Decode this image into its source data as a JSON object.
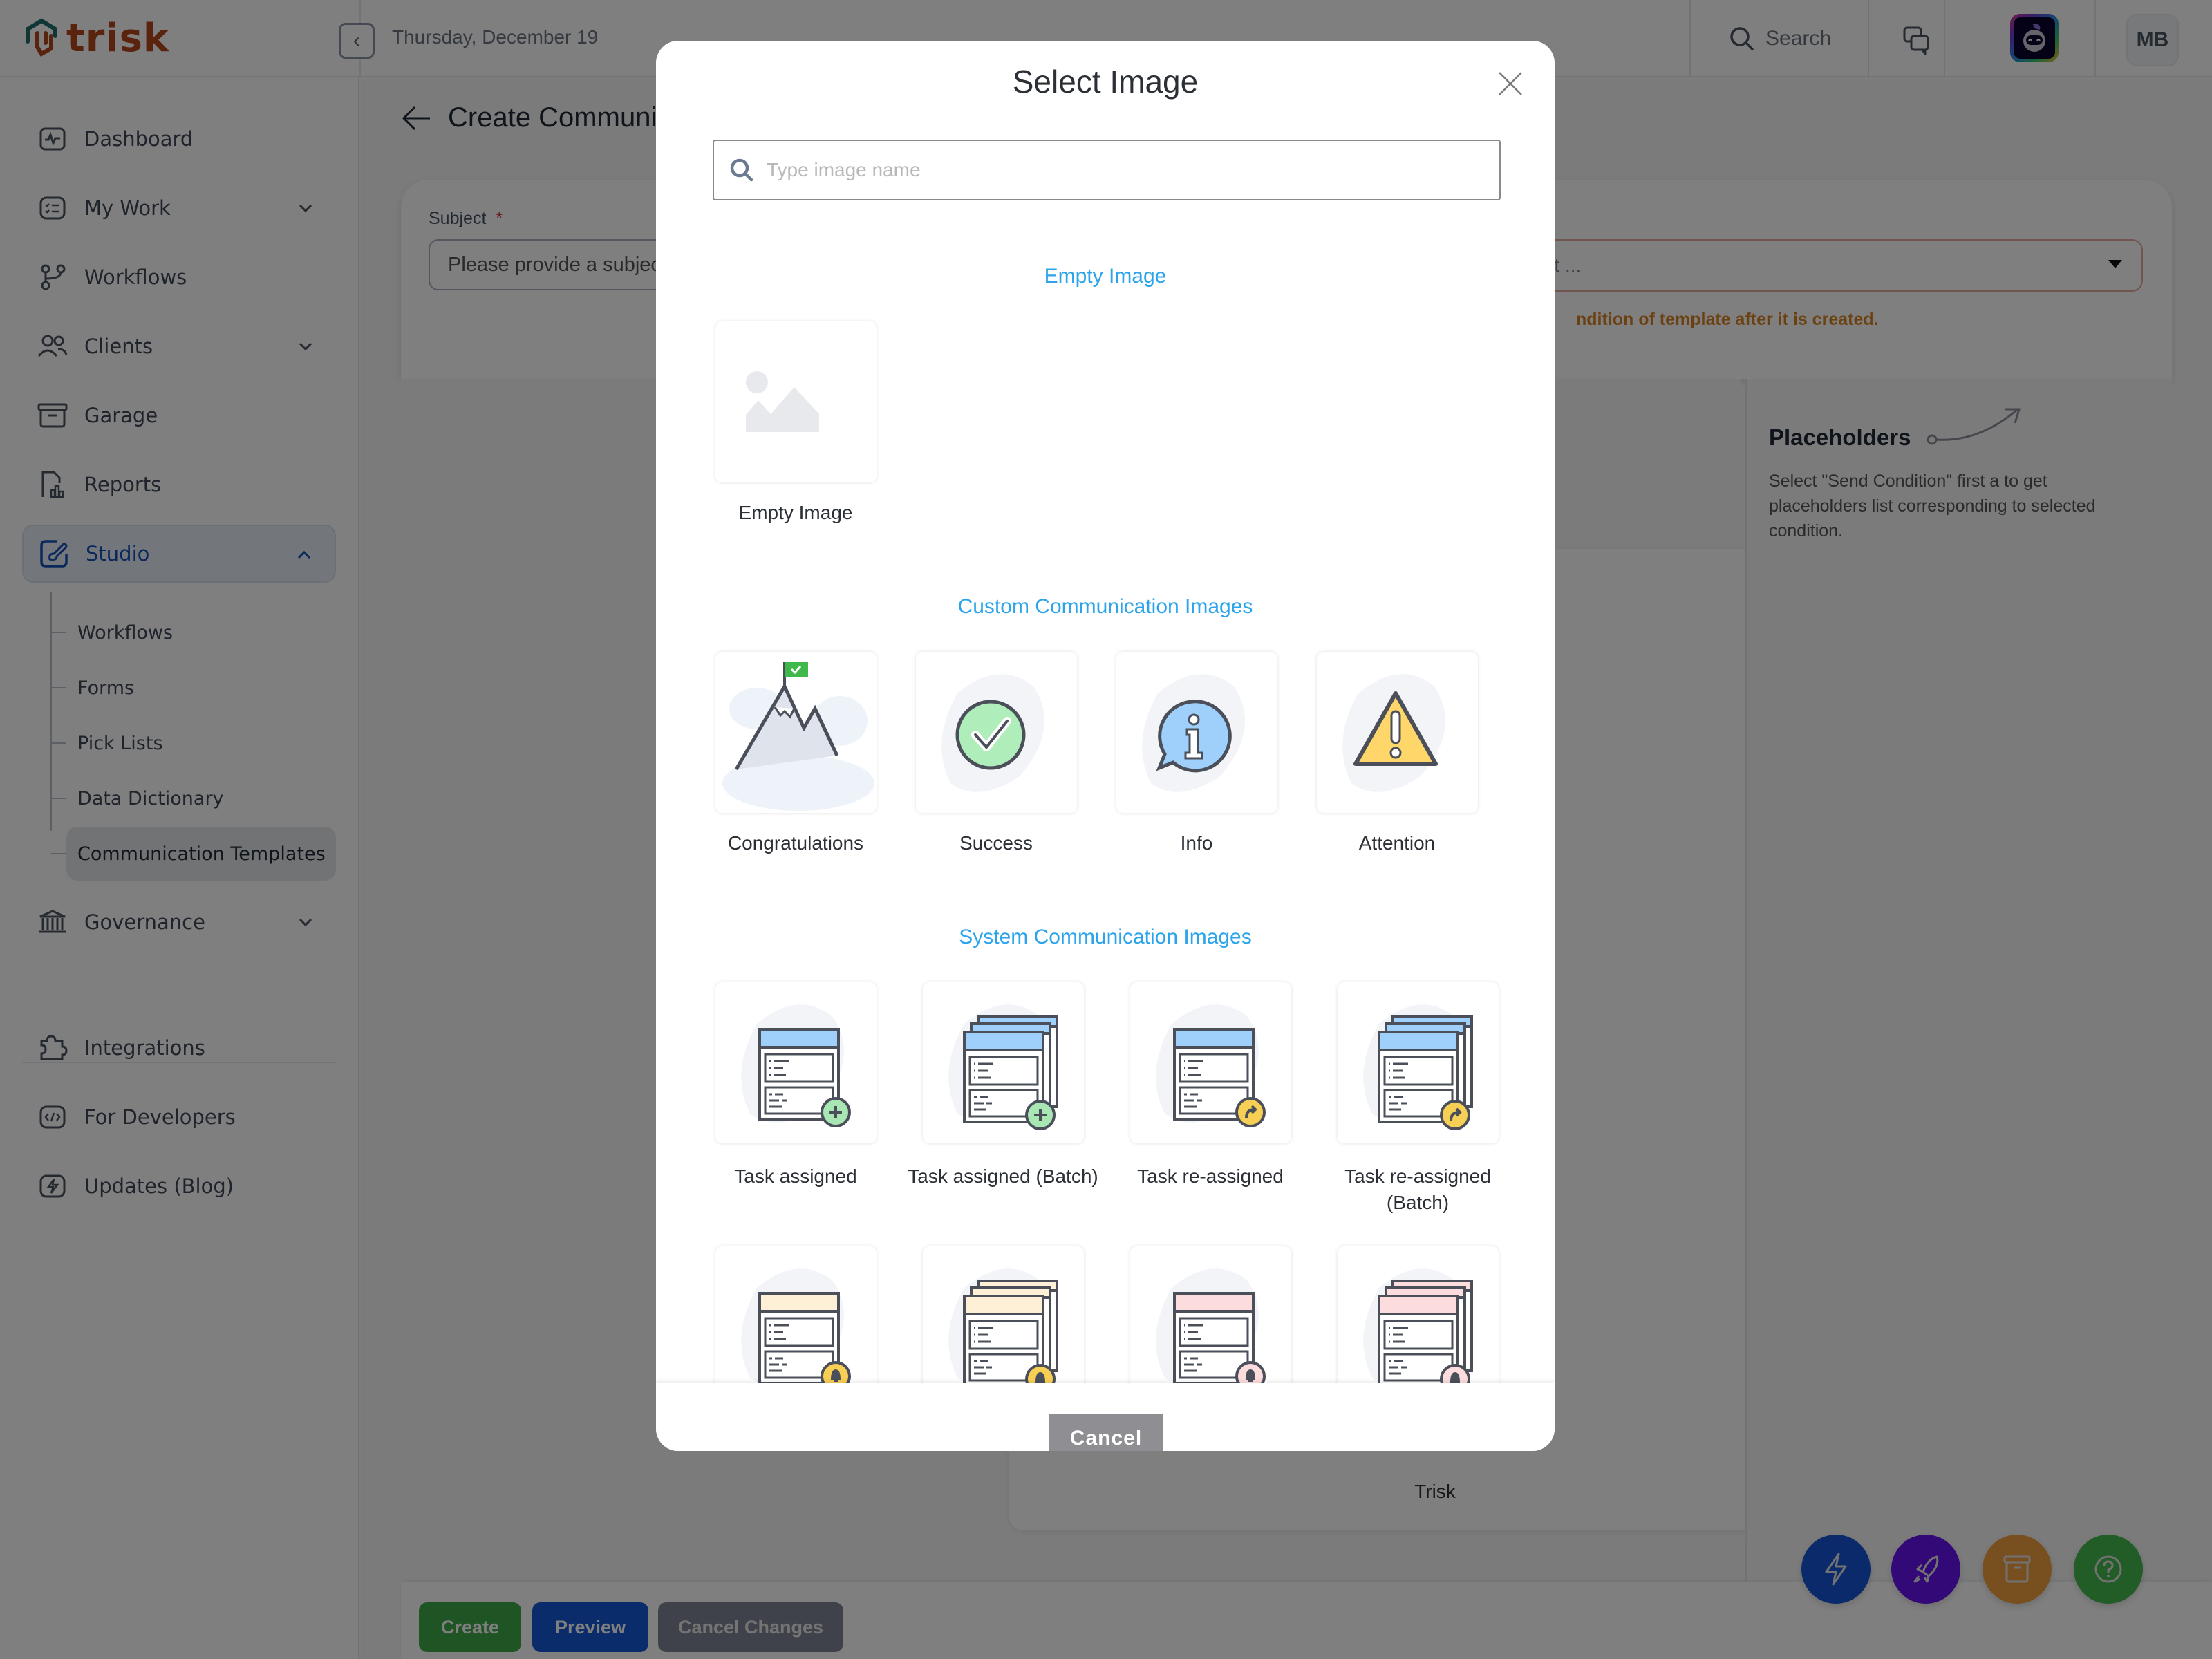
{
  "app": {
    "logo_text": "trisk",
    "date": "Thursday, December 19",
    "search_label": "Search",
    "user_initials": "MB"
  },
  "sidebar": {
    "items": [
      {
        "label": "Dashboard",
        "icon": "dashboard-icon"
      },
      {
        "label": "My Work",
        "icon": "checklist-icon",
        "expandable": true
      },
      {
        "label": "Workflows",
        "icon": "branch-icon"
      },
      {
        "label": "Clients",
        "icon": "users-icon",
        "expandable": true
      },
      {
        "label": "Garage",
        "icon": "archive-icon"
      },
      {
        "label": "Reports",
        "icon": "report-icon"
      },
      {
        "label": "Studio",
        "icon": "studio-icon",
        "expandable": true,
        "expanded": true,
        "active": true
      },
      {
        "label": "Governance",
        "icon": "bank-icon",
        "expandable": true
      },
      {
        "label": "Integrations",
        "icon": "puzzle-icon"
      },
      {
        "label": "For Developers",
        "icon": "code-icon"
      },
      {
        "label": "Updates (Blog)",
        "icon": "bolt-icon"
      }
    ],
    "studio_sub": [
      {
        "label": "Workflows"
      },
      {
        "label": "Forms"
      },
      {
        "label": "Pick Lists"
      },
      {
        "label": "Data Dictionary"
      },
      {
        "label": "Communication Templates",
        "active": true
      }
    ]
  },
  "page": {
    "title": "Create Communi",
    "subject_label": "Subject",
    "subject_required": "*",
    "subject_placeholder": "Please provide a subject",
    "condition_placeholder": "list ...",
    "condition_warning": "ndition of template after it is created.",
    "preview_footer": "Trisk",
    "placeholders_title": "Placeholders",
    "placeholders_desc": "Select \"Send Condition\" first a to get placeholders list corresponding to selected condition.",
    "buttons": {
      "create": "Create",
      "preview": "Preview",
      "cancel_changes": "Cancel Changes"
    },
    "fabs": [
      {
        "icon": "lightning-icon",
        "color": "#1455d9"
      },
      {
        "icon": "rocket-icon",
        "color": "#6412ee"
      },
      {
        "icon": "archive-icon",
        "color": "#f0a040"
      },
      {
        "icon": "help-icon",
        "color": "#44b84e"
      }
    ]
  },
  "modal": {
    "title": "Select Image",
    "search_placeholder": "Type image name",
    "search_value": "",
    "cancel_label": "Cancel",
    "sections": [
      {
        "title": "Empty Image",
        "images": [
          {
            "label": "Empty Image",
            "kind": "empty"
          }
        ]
      },
      {
        "title": "Custom Communication Images",
        "images": [
          {
            "label": "Congratulations",
            "kind": "mountain"
          },
          {
            "label": "Success",
            "kind": "success"
          },
          {
            "label": "Info",
            "kind": "info"
          },
          {
            "label": "Attention",
            "kind": "attention"
          }
        ]
      },
      {
        "title": "System Communication Images",
        "images": [
          {
            "label": "Task assigned",
            "kind": "task",
            "header": "#9fd0fb",
            "badge": "#a8e6b4",
            "badge_glyph": "plus",
            "batch": false
          },
          {
            "label": "Task assigned (Batch)",
            "kind": "task",
            "header": "#9fd0fb",
            "badge": "#a8e6b4",
            "badge_glyph": "plus",
            "batch": true
          },
          {
            "label": "Task re-assigned",
            "kind": "task",
            "header": "#9fd0fb",
            "badge": "#f7cf55",
            "badge_glyph": "arrow",
            "batch": false
          },
          {
            "label": "Task re-assigned (Batch)",
            "kind": "task",
            "header": "#9fd0fb",
            "badge": "#f7cf55",
            "badge_glyph": "arrow",
            "batch": true
          },
          {
            "label": "",
            "kind": "task",
            "header": "#fdf0d6",
            "badge": "#f7cf55",
            "badge_glyph": "bell",
            "batch": false
          },
          {
            "label": "",
            "kind": "task",
            "header": "#fdf0d6",
            "badge": "#f7cf55",
            "badge_glyph": "bell",
            "batch": true
          },
          {
            "label": "",
            "kind": "task",
            "header": "#fcdcdc",
            "badge": "#fcdcdc",
            "badge_glyph": "bell",
            "batch": false
          },
          {
            "label": "",
            "kind": "task",
            "header": "#fcdcdc",
            "badge": "#fcdcdc",
            "badge_glyph": "bell",
            "batch": true
          }
        ]
      }
    ]
  }
}
